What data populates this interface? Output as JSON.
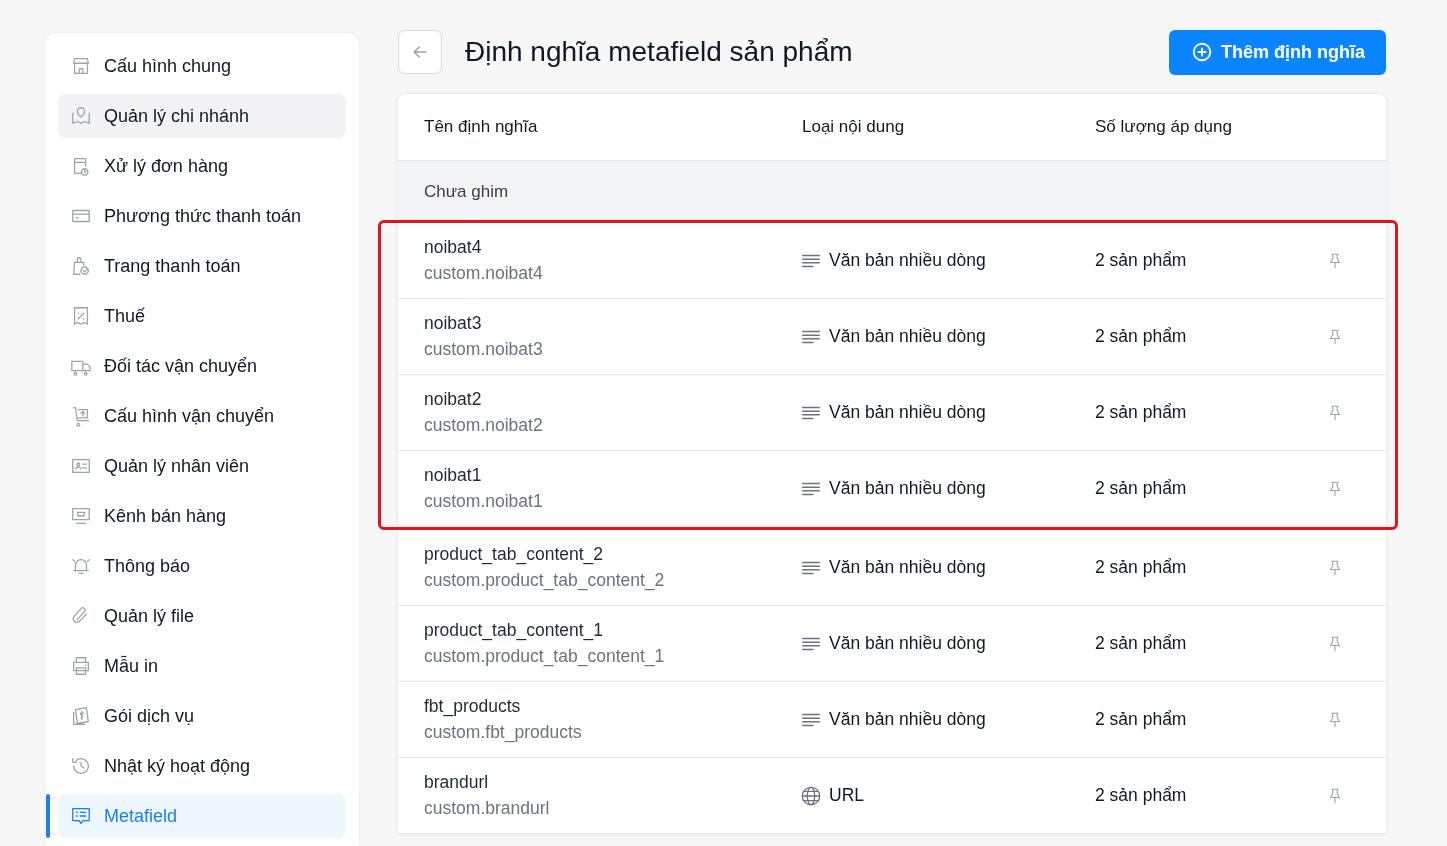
{
  "sidebar": {
    "items": [
      {
        "label": "Cấu hình chung",
        "selected": false,
        "hovered": false
      },
      {
        "label": "Quản lý chi nhánh",
        "selected": false,
        "hovered": true
      },
      {
        "label": "Xử lý đơn hàng",
        "selected": false,
        "hovered": false
      },
      {
        "label": "Phương thức thanh toán",
        "selected": false,
        "hovered": false
      },
      {
        "label": "Trang thanh toán",
        "selected": false,
        "hovered": false
      },
      {
        "label": "Thuế",
        "selected": false,
        "hovered": false
      },
      {
        "label": "Đối tác vận chuyển",
        "selected": false,
        "hovered": false
      },
      {
        "label": "Cấu hình vận chuyển",
        "selected": false,
        "hovered": false
      },
      {
        "label": "Quản lý nhân viên",
        "selected": false,
        "hovered": false
      },
      {
        "label": "Kênh bán hàng",
        "selected": false,
        "hovered": false
      },
      {
        "label": "Thông báo",
        "selected": false,
        "hovered": false
      },
      {
        "label": "Quản lý file",
        "selected": false,
        "hovered": false
      },
      {
        "label": "Mẫu in",
        "selected": false,
        "hovered": false
      },
      {
        "label": "Gói dịch vụ",
        "selected": false,
        "hovered": false
      },
      {
        "label": "Nhật ký hoạt động",
        "selected": false,
        "hovered": false
      },
      {
        "label": "Metafield",
        "selected": true,
        "hovered": false
      }
    ]
  },
  "page": {
    "title": "Định nghĩa metafield sản phẩm",
    "add_button": "Thêm định nghĩa"
  },
  "table": {
    "columns": [
      "Tên định nghĩa",
      "Loại nội dung",
      "Số lượng áp dụng"
    ],
    "group": "Chưa ghim",
    "rows": [
      {
        "name": "noibat4",
        "key": "custom.noibat4",
        "kind": "multiline",
        "type": "Văn bản nhiều dòng",
        "count": "2 sản phẩm",
        "highlighted": true
      },
      {
        "name": "noibat3",
        "key": "custom.noibat3",
        "kind": "multiline",
        "type": "Văn bản nhiều dòng",
        "count": "2 sản phẩm",
        "highlighted": true
      },
      {
        "name": "noibat2",
        "key": "custom.noibat2",
        "kind": "multiline",
        "type": "Văn bản nhiều dòng",
        "count": "2 sản phẩm",
        "highlighted": true
      },
      {
        "name": "noibat1",
        "key": "custom.noibat1",
        "kind": "multiline",
        "type": "Văn bản nhiều dòng",
        "count": "2 sản phẩm",
        "highlighted": true
      },
      {
        "name": "product_tab_content_2",
        "key": "custom.product_tab_content_2",
        "kind": "multiline",
        "type": "Văn bản nhiều dòng",
        "count": "2 sản phẩm",
        "highlighted": false
      },
      {
        "name": "product_tab_content_1",
        "key": "custom.product_tab_content_1",
        "kind": "multiline",
        "type": "Văn bản nhiều dòng",
        "count": "2 sản phẩm",
        "highlighted": false
      },
      {
        "name": "fbt_products",
        "key": "custom.fbt_products",
        "kind": "multiline",
        "type": "Văn bản nhiều dòng",
        "count": "2 sản phẩm",
        "highlighted": false
      },
      {
        "name": "brandurl",
        "key": "custom.brandurl",
        "kind": "url",
        "type": "URL",
        "count": "2 sản phẩm",
        "highlighted": false
      }
    ]
  }
}
